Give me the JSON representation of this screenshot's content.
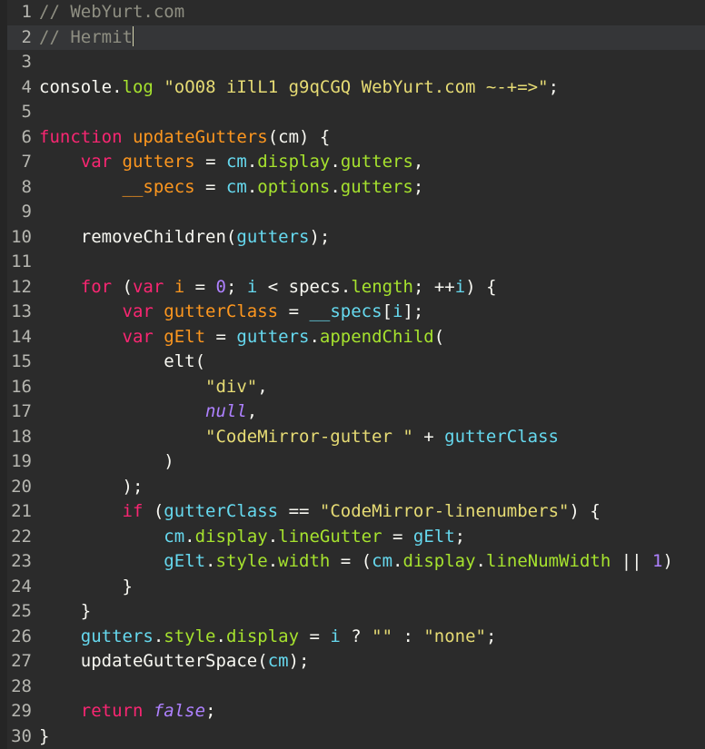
{
  "editor": {
    "name": "code-editor",
    "language": "javascript",
    "theme": "monokai-dark",
    "colors": {
      "background": "#2b2b2b",
      "gutter_background": "#252525",
      "active_line_background": "#353638",
      "line_number": "#b6b6b0",
      "default_text": "#f8f8f2",
      "comment": "#8f8f82",
      "keyword": "#f92672",
      "function": "#fd971f",
      "variable": "#fd971f",
      "property": "#a6e22e",
      "identifier": "#66d9ef",
      "string": "#e6db74",
      "number": "#ae81ff",
      "atom": "#ae81ff",
      "caret": "#d6d6b0"
    },
    "total_lines": 30,
    "active_line": 2,
    "cursor_line": 2,
    "cursor_column": 10
  },
  "lines": [
    {
      "number": "1",
      "active": false,
      "text": "// WebYurt.com",
      "tokens": [
        {
          "t": "// WebYurt.com",
          "c": "t-comment"
        }
      ]
    },
    {
      "number": "2",
      "active": true,
      "text": "// Hermit",
      "tokens": [
        {
          "t": "// Hermit",
          "c": "t-comment"
        }
      ],
      "caret": true
    },
    {
      "number": "3",
      "active": false,
      "text": "",
      "tokens": []
    },
    {
      "number": "4",
      "active": false,
      "text": "console.log \"oO08 iIlL1 g9qCGQ WebYurt.com ~-+=>\";",
      "tokens": [
        {
          "t": "console",
          "c": "t-default"
        },
        {
          "t": ".",
          "c": "t-default"
        },
        {
          "t": "log",
          "c": "t-prop"
        },
        {
          "t": " ",
          "c": "t-default"
        },
        {
          "t": "\"oO08 iIlL1 g9qCGQ WebYurt.com ~-+=>\"",
          "c": "t-string"
        },
        {
          "t": ";",
          "c": "t-punct"
        }
      ]
    },
    {
      "number": "5",
      "active": false,
      "text": "",
      "tokens": []
    },
    {
      "number": "6",
      "active": false,
      "text": "function updateGutters(cm) {",
      "tokens": [
        {
          "t": "function",
          "c": "t-keyword"
        },
        {
          "t": " ",
          "c": "t-default"
        },
        {
          "t": "updateGutters",
          "c": "t-func"
        },
        {
          "t": "(",
          "c": "t-punct"
        },
        {
          "t": "cm",
          "c": "t-default"
        },
        {
          "t": ") {",
          "c": "t-punct"
        }
      ]
    },
    {
      "number": "7",
      "active": false,
      "text": "    var gutters = cm.display.gutters,",
      "tokens": [
        {
          "t": "    ",
          "c": "t-default"
        },
        {
          "t": "var",
          "c": "t-keyword"
        },
        {
          "t": " ",
          "c": "t-default"
        },
        {
          "t": "gutters",
          "c": "t-var"
        },
        {
          "t": " = ",
          "c": "t-op"
        },
        {
          "t": "cm",
          "c": "t-ident"
        },
        {
          "t": ".",
          "c": "t-default"
        },
        {
          "t": "display",
          "c": "t-prop"
        },
        {
          "t": ".",
          "c": "t-default"
        },
        {
          "t": "gutters",
          "c": "t-prop"
        },
        {
          "t": ",",
          "c": "t-punct"
        }
      ]
    },
    {
      "number": "8",
      "active": false,
      "text": "        __specs = cm.options.gutters;",
      "tokens": [
        {
          "t": "        ",
          "c": "t-default"
        },
        {
          "t": "__specs",
          "c": "t-var"
        },
        {
          "t": " = ",
          "c": "t-op"
        },
        {
          "t": "cm",
          "c": "t-ident"
        },
        {
          "t": ".",
          "c": "t-default"
        },
        {
          "t": "options",
          "c": "t-prop"
        },
        {
          "t": ".",
          "c": "t-default"
        },
        {
          "t": "gutters",
          "c": "t-prop"
        },
        {
          "t": ";",
          "c": "t-punct"
        }
      ]
    },
    {
      "number": "9",
      "active": false,
      "text": "",
      "tokens": []
    },
    {
      "number": "10",
      "active": false,
      "text": "    removeChildren(gutters);",
      "tokens": [
        {
          "t": "    ",
          "c": "t-default"
        },
        {
          "t": "removeChildren",
          "c": "t-default"
        },
        {
          "t": "(",
          "c": "t-punct"
        },
        {
          "t": "gutters",
          "c": "t-ident"
        },
        {
          "t": ");",
          "c": "t-punct"
        }
      ]
    },
    {
      "number": "11",
      "active": false,
      "text": "",
      "tokens": []
    },
    {
      "number": "12",
      "active": false,
      "text": "    for (var i = 0; i < specs.length; ++i) {",
      "tokens": [
        {
          "t": "    ",
          "c": "t-default"
        },
        {
          "t": "for",
          "c": "t-keyword"
        },
        {
          "t": " (",
          "c": "t-punct"
        },
        {
          "t": "var",
          "c": "t-keyword"
        },
        {
          "t": " ",
          "c": "t-default"
        },
        {
          "t": "i",
          "c": "t-var"
        },
        {
          "t": " = ",
          "c": "t-op"
        },
        {
          "t": "0",
          "c": "t-number"
        },
        {
          "t": "; ",
          "c": "t-punct"
        },
        {
          "t": "i",
          "c": "t-ident"
        },
        {
          "t": " < ",
          "c": "t-op"
        },
        {
          "t": "specs",
          "c": "t-default"
        },
        {
          "t": ".",
          "c": "t-default"
        },
        {
          "t": "length",
          "c": "t-prop"
        },
        {
          "t": "; ++",
          "c": "t-punct"
        },
        {
          "t": "i",
          "c": "t-ident"
        },
        {
          "t": ") {",
          "c": "t-punct"
        }
      ]
    },
    {
      "number": "13",
      "active": false,
      "text": "        var gutterClass = __specs[i];",
      "tokens": [
        {
          "t": "        ",
          "c": "t-default"
        },
        {
          "t": "var",
          "c": "t-keyword"
        },
        {
          "t": " ",
          "c": "t-default"
        },
        {
          "t": "gutterClass",
          "c": "t-var"
        },
        {
          "t": " = ",
          "c": "t-op"
        },
        {
          "t": "__specs",
          "c": "t-ident"
        },
        {
          "t": "[",
          "c": "t-punct"
        },
        {
          "t": "i",
          "c": "t-ident"
        },
        {
          "t": "];",
          "c": "t-punct"
        }
      ]
    },
    {
      "number": "14",
      "active": false,
      "text": "        var gElt = gutters.appendChild(",
      "tokens": [
        {
          "t": "        ",
          "c": "t-default"
        },
        {
          "t": "var",
          "c": "t-keyword"
        },
        {
          "t": " ",
          "c": "t-default"
        },
        {
          "t": "gElt",
          "c": "t-var"
        },
        {
          "t": " = ",
          "c": "t-op"
        },
        {
          "t": "gutters",
          "c": "t-ident"
        },
        {
          "t": ".",
          "c": "t-default"
        },
        {
          "t": "appendChild",
          "c": "t-prop"
        },
        {
          "t": "(",
          "c": "t-punct"
        }
      ]
    },
    {
      "number": "15",
      "active": false,
      "text": "            elt(",
      "tokens": [
        {
          "t": "            ",
          "c": "t-default"
        },
        {
          "t": "elt",
          "c": "t-default"
        },
        {
          "t": "(",
          "c": "t-punct"
        }
      ]
    },
    {
      "number": "16",
      "active": false,
      "text": "                \"div\",",
      "tokens": [
        {
          "t": "                ",
          "c": "t-default"
        },
        {
          "t": "\"div\"",
          "c": "t-string"
        },
        {
          "t": ",",
          "c": "t-punct"
        }
      ]
    },
    {
      "number": "17",
      "active": false,
      "text": "                null,",
      "tokens": [
        {
          "t": "                ",
          "c": "t-default"
        },
        {
          "t": "null",
          "c": "t-atom"
        },
        {
          "t": ",",
          "c": "t-punct"
        }
      ]
    },
    {
      "number": "18",
      "active": false,
      "text": "                \"CodeMirror-gutter \" + gutterClass",
      "tokens": [
        {
          "t": "                ",
          "c": "t-default"
        },
        {
          "t": "\"CodeMirror-gutter \"",
          "c": "t-string"
        },
        {
          "t": " + ",
          "c": "t-op"
        },
        {
          "t": "gutterClass",
          "c": "t-ident"
        }
      ]
    },
    {
      "number": "19",
      "active": false,
      "text": "            )",
      "tokens": [
        {
          "t": "            ",
          "c": "t-default"
        },
        {
          "t": ")",
          "c": "t-punct"
        }
      ]
    },
    {
      "number": "20",
      "active": false,
      "text": "        );",
      "tokens": [
        {
          "t": "        ",
          "c": "t-default"
        },
        {
          "t": ");",
          "c": "t-punct"
        }
      ]
    },
    {
      "number": "21",
      "active": false,
      "text": "        if (gutterClass == \"CodeMirror-linenumbers\") {",
      "tokens": [
        {
          "t": "        ",
          "c": "t-default"
        },
        {
          "t": "if",
          "c": "t-keyword"
        },
        {
          "t": " (",
          "c": "t-punct"
        },
        {
          "t": "gutterClass",
          "c": "t-ident"
        },
        {
          "t": " == ",
          "c": "t-op"
        },
        {
          "t": "\"CodeMirror-linenumbers\"",
          "c": "t-string"
        },
        {
          "t": ") {",
          "c": "t-punct"
        }
      ]
    },
    {
      "number": "22",
      "active": false,
      "text": "            cm.display.lineGutter = gElt;",
      "tokens": [
        {
          "t": "            ",
          "c": "t-default"
        },
        {
          "t": "cm",
          "c": "t-ident"
        },
        {
          "t": ".",
          "c": "t-default"
        },
        {
          "t": "display",
          "c": "t-prop"
        },
        {
          "t": ".",
          "c": "t-default"
        },
        {
          "t": "lineGutter",
          "c": "t-prop"
        },
        {
          "t": " = ",
          "c": "t-op"
        },
        {
          "t": "gElt",
          "c": "t-ident"
        },
        {
          "t": ";",
          "c": "t-punct"
        }
      ]
    },
    {
      "number": "23",
      "active": false,
      "text": "            gElt.style.width = (cm.display.lineNumWidth || 1)",
      "truncated": true,
      "tokens": [
        {
          "t": "            ",
          "c": "t-default"
        },
        {
          "t": "gElt",
          "c": "t-ident"
        },
        {
          "t": ".",
          "c": "t-default"
        },
        {
          "t": "style",
          "c": "t-prop"
        },
        {
          "t": ".",
          "c": "t-default"
        },
        {
          "t": "width",
          "c": "t-prop"
        },
        {
          "t": " = (",
          "c": "t-op"
        },
        {
          "t": "cm",
          "c": "t-ident"
        },
        {
          "t": ".",
          "c": "t-default"
        },
        {
          "t": "display",
          "c": "t-prop"
        },
        {
          "t": ".",
          "c": "t-default"
        },
        {
          "t": "lineNumWidth",
          "c": "t-prop"
        },
        {
          "t": " || ",
          "c": "t-op"
        },
        {
          "t": "1",
          "c": "t-number"
        },
        {
          "t": ")",
          "c": "t-punct"
        }
      ]
    },
    {
      "number": "24",
      "active": false,
      "text": "        }",
      "tokens": [
        {
          "t": "        ",
          "c": "t-default"
        },
        {
          "t": "}",
          "c": "t-punct"
        }
      ]
    },
    {
      "number": "25",
      "active": false,
      "text": "    }",
      "tokens": [
        {
          "t": "    ",
          "c": "t-default"
        },
        {
          "t": "}",
          "c": "t-punct"
        }
      ]
    },
    {
      "number": "26",
      "active": false,
      "text": "    gutters.style.display = i ? \"\" : \"none\";",
      "tokens": [
        {
          "t": "    ",
          "c": "t-default"
        },
        {
          "t": "gutters",
          "c": "t-ident"
        },
        {
          "t": ".",
          "c": "t-default"
        },
        {
          "t": "style",
          "c": "t-prop"
        },
        {
          "t": ".",
          "c": "t-default"
        },
        {
          "t": "display",
          "c": "t-prop"
        },
        {
          "t": " = ",
          "c": "t-op"
        },
        {
          "t": "i",
          "c": "t-ident"
        },
        {
          "t": " ? ",
          "c": "t-op"
        },
        {
          "t": "\"\"",
          "c": "t-string"
        },
        {
          "t": " : ",
          "c": "t-op"
        },
        {
          "t": "\"none\"",
          "c": "t-string"
        },
        {
          "t": ";",
          "c": "t-punct"
        }
      ]
    },
    {
      "number": "27",
      "active": false,
      "text": "    updateGutterSpace(cm);",
      "tokens": [
        {
          "t": "    ",
          "c": "t-default"
        },
        {
          "t": "updateGutterSpace",
          "c": "t-default"
        },
        {
          "t": "(",
          "c": "t-punct"
        },
        {
          "t": "cm",
          "c": "t-ident"
        },
        {
          "t": ");",
          "c": "t-punct"
        }
      ]
    },
    {
      "number": "28",
      "active": false,
      "text": "",
      "tokens": []
    },
    {
      "number": "29",
      "active": false,
      "text": "    return false;",
      "tokens": [
        {
          "t": "    ",
          "c": "t-default"
        },
        {
          "t": "return",
          "c": "t-keyword"
        },
        {
          "t": " ",
          "c": "t-default"
        },
        {
          "t": "false",
          "c": "t-atom"
        },
        {
          "t": ";",
          "c": "t-punct"
        }
      ]
    },
    {
      "number": "30",
      "active": false,
      "text": "}",
      "tokens": [
        {
          "t": "}",
          "c": "t-punct"
        }
      ]
    }
  ]
}
